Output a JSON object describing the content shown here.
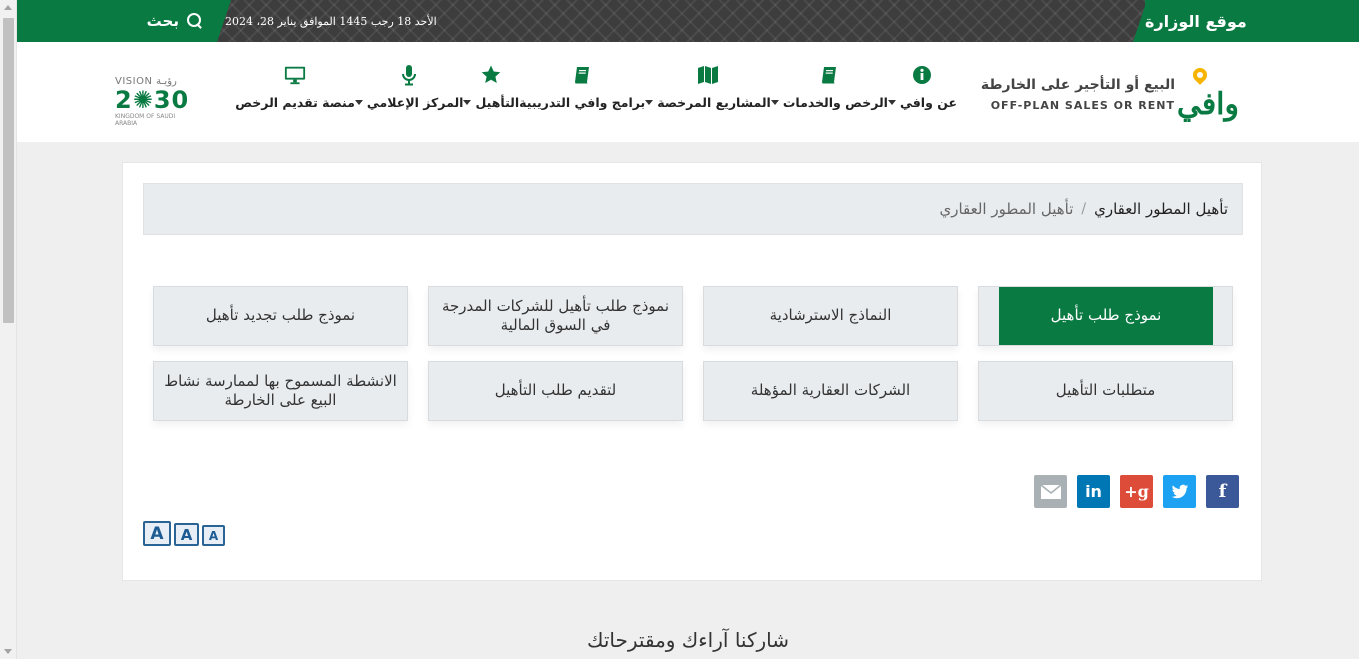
{
  "topbar": {
    "ministry_label": "موقع الوزارة",
    "search_label": "بحث",
    "date": "الأحد 18 رجب 1445 الموافق يناير 28، 2024"
  },
  "logo": {
    "wordmark": "وافي",
    "arabic_tagline": "البيع أو التأجير على الخارطة",
    "english_tagline": "OFF-PLAN SALES OR RENT"
  },
  "nav": {
    "items": [
      {
        "label": "عن وافي",
        "icon": "info-icon",
        "dropdown": true
      },
      {
        "label": "الرخص والخدمات",
        "icon": "book-icon",
        "dropdown": true
      },
      {
        "label": "المشاريع المرخصة",
        "icon": "map-icon",
        "dropdown": true
      },
      {
        "label": "برامج وافي التدريبية",
        "icon": "book-icon",
        "dropdown": false
      },
      {
        "label": "التأهيل",
        "icon": "star-icon",
        "dropdown": true
      },
      {
        "label": "المركز الإعلامي",
        "icon": "microphone-icon",
        "dropdown": true
      },
      {
        "label": "منصة تقديم الرخص",
        "icon": "monitor-icon",
        "dropdown": false
      }
    ]
  },
  "vision": {
    "line1": "VISION رؤيـة",
    "year_a": "2",
    "year_b": "30",
    "line3": "KINGDOM OF SAUDI ARABIA"
  },
  "breadcrumb": {
    "current": "تأهيل المطور العقاري",
    "separator": "/",
    "item": "تأهيل المطور العقاري"
  },
  "tiles": {
    "t1": "نموذج طلب تأهيل",
    "t2": "النماذج الاسترشادية",
    "t3": "نموذج طلب تأهيل للشركات المدرجة في السوق المالية",
    "t4": "نموذج طلب تجديد تأهيل",
    "t5": "متطلبات التأهيل",
    "t6": "الشركات العقارية المؤهلة",
    "t7": "لتقديم طلب التأهيل",
    "t8": "الانشطة المسموح بها لممارسة نشاط البيع على الخارطة"
  },
  "share": {
    "facebook": "f",
    "twitter_color": "#1da1f2",
    "google": "g+",
    "linkedin": "in",
    "facebook_color": "#3b5998",
    "google_color": "#dd4b39",
    "linkedin_color": "#0077b5",
    "email_color": "#aab1b4"
  },
  "fontsize": {
    "large": "A",
    "medium": "A",
    "small": "A"
  },
  "feedback": {
    "title": "شاركنا آراءك ومقترحاتك"
  },
  "colors": {
    "brand_green": "#0a7a43",
    "accent_yellow": "#f6b400"
  }
}
